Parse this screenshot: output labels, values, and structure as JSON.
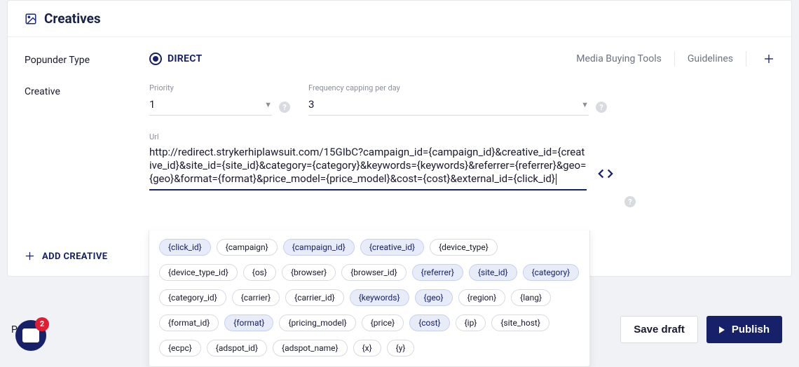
{
  "header": {
    "title": "Creatives"
  },
  "popunder": {
    "label": "Popunder Type",
    "option": "DIRECT",
    "media_buying": "Media Buying Tools",
    "guidelines": "Guidelines"
  },
  "creative": {
    "label": "Creative",
    "priority_label": "Priority",
    "priority_value": "1",
    "freq_label": "Frequency capping per day",
    "freq_value": "3",
    "url_label": "Url",
    "url_value": "http://redirect.strykerhiplawsuit.com/15GIbC?campaign_id={campaign_id}&creative_id={creative_id}&site_id={site_id}&category={category}&keywords={keywords}&referrer={referrer}&geo={geo}&format={format}&price_model={price_model}&cost={cost}&external_id={click_id}"
  },
  "add_creative": "ADD CREATIVE",
  "tags": [
    {
      "label": "{click_id}",
      "selected": true
    },
    {
      "label": "{campaign}",
      "selected": false
    },
    {
      "label": "{campaign_id}",
      "selected": true
    },
    {
      "label": "{creative_id}",
      "selected": true
    },
    {
      "label": "{device_type}",
      "selected": false
    },
    {
      "label": "{device_type_id}",
      "selected": false
    },
    {
      "label": "{os}",
      "selected": false
    },
    {
      "label": "{browser}",
      "selected": false
    },
    {
      "label": "{browser_id}",
      "selected": false
    },
    {
      "label": "{referrer}",
      "selected": true
    },
    {
      "label": "{site_id}",
      "selected": true
    },
    {
      "label": "{category}",
      "selected": true
    },
    {
      "label": "{category_id}",
      "selected": false
    },
    {
      "label": "{carrier}",
      "selected": false
    },
    {
      "label": "{carrier_id}",
      "selected": false
    },
    {
      "label": "{keywords}",
      "selected": true
    },
    {
      "label": "{geo}",
      "selected": true
    },
    {
      "label": "{region}",
      "selected": false
    },
    {
      "label": "{lang}",
      "selected": false
    },
    {
      "label": "{format_id}",
      "selected": false
    },
    {
      "label": "{format}",
      "selected": true
    },
    {
      "label": "{pricing_model}",
      "selected": false
    },
    {
      "label": "{price}",
      "selected": false
    },
    {
      "label": "{cost}",
      "selected": true
    },
    {
      "label": "{ip}",
      "selected": false
    },
    {
      "label": "{site_host}",
      "selected": false
    },
    {
      "label": "{ecpc}",
      "selected": false
    },
    {
      "label": "{adspot_id}",
      "selected": false
    },
    {
      "label": "{adspot_name}",
      "selected": false
    },
    {
      "label": "{x}",
      "selected": false
    },
    {
      "label": "{y}",
      "selected": false
    }
  ],
  "footer": {
    "preview": "Preview",
    "badge": "2",
    "save_draft": "Save draft",
    "publish": "Publish"
  }
}
